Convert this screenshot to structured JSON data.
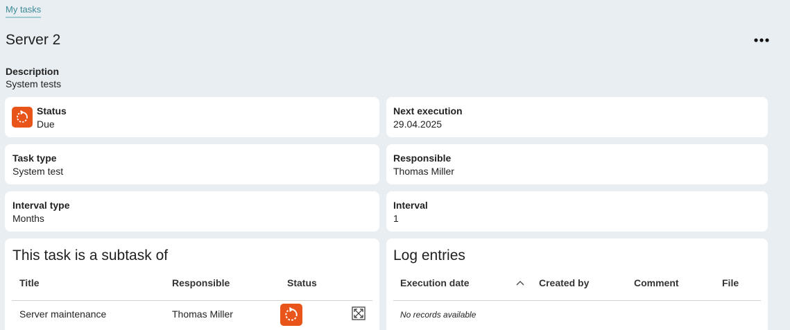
{
  "breadcrumb": {
    "label": "My tasks"
  },
  "page": {
    "title": "Server 2"
  },
  "more_icon": "more-horizontal-icon",
  "description": {
    "label": "Description",
    "value": "System tests"
  },
  "fields": {
    "status": {
      "label": "Status",
      "value": "Due",
      "icon": "refresh-icon",
      "icon_color": "#e8541a"
    },
    "next_execution": {
      "label": "Next execution",
      "value": "29.04.2025"
    },
    "task_type": {
      "label": "Task type",
      "value": "System test"
    },
    "responsible": {
      "label": "Responsible",
      "value": "Thomas Miller"
    },
    "interval_type": {
      "label": "Interval type",
      "value": "Months"
    },
    "interval": {
      "label": "Interval",
      "value": "1"
    }
  },
  "subtask": {
    "title": "This task is a subtask of",
    "columns": [
      "Title",
      "Responsible",
      "Status"
    ],
    "rows": [
      {
        "title": "Server maintenance",
        "responsible": "Thomas Miller",
        "status_icon": "refresh-icon",
        "action_icon": "expand-icon"
      }
    ]
  },
  "log": {
    "title": "Log entries",
    "columns": [
      "Execution date",
      "Created by",
      "Comment",
      "File"
    ],
    "sort_icon": "chevron-up-icon",
    "empty_text": "No records available"
  },
  "colors": {
    "background": "#e8eef1",
    "accent": "#e8541a",
    "link": "#3d8a96"
  }
}
